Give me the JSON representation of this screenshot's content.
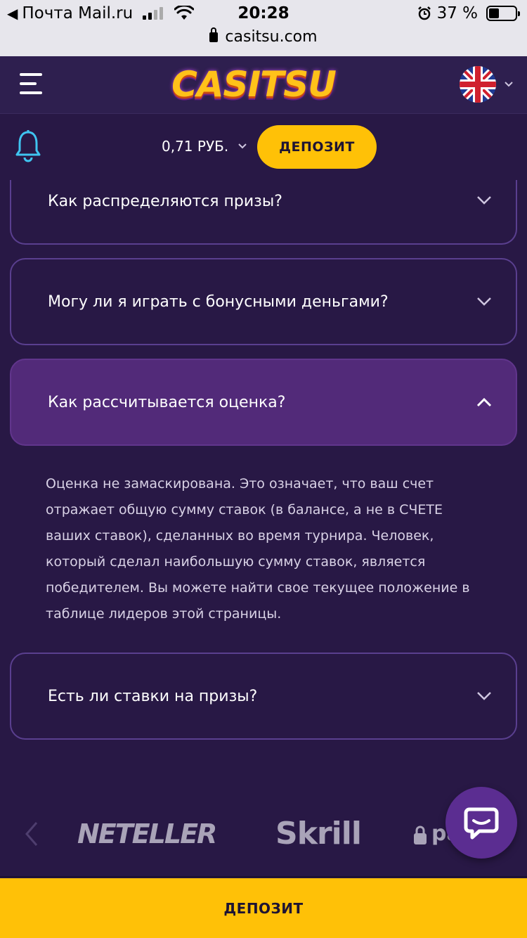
{
  "status_bar": {
    "carrier": "Почта Mail.ru",
    "time": "20:28",
    "battery": "37 %",
    "url": "casitsu.com"
  },
  "header": {
    "logo_text": "CASITSU",
    "language_icon": "uk-flag-icon"
  },
  "account": {
    "balance": "0,71 РУБ.",
    "deposit_label": "ДЕПОЗИТ"
  },
  "faq": {
    "items": [
      {
        "question": "Как распределяются призы?",
        "open": false
      },
      {
        "question": "Могу ли я играть с бонусными деньгами?",
        "open": false
      },
      {
        "question": "Как рассчитывается оценка?",
        "open": true
      },
      {
        "question": "Есть ли ставки на призы?",
        "open": false
      }
    ],
    "answer_lines": [
      "Оценка не замаскирована. Это означает, что ваш счет",
      "отражает общую сумму ставок (в балансе, а не в СЧЕТЕ",
      "ваших ставок), сделанных во время турнира. Человек,",
      "который сделал наибольшую сумму ставок, является",
      "победителем. Вы можете найти свое текущее положение в",
      "таблице лидеров этой страницы."
    ]
  },
  "payments": {
    "providers": [
      "NETELLER",
      "Skrill",
      "pa"
    ]
  },
  "bottom_bar": {
    "deposit_label": "ДЕПОЗИТ"
  },
  "colors": {
    "background": "#281845",
    "header": "#2e1f4f",
    "accent_yellow": "#ffc107",
    "open_item": "#522a79",
    "border": "#5a3f8f",
    "bell_icon": "#3fc4f0"
  }
}
